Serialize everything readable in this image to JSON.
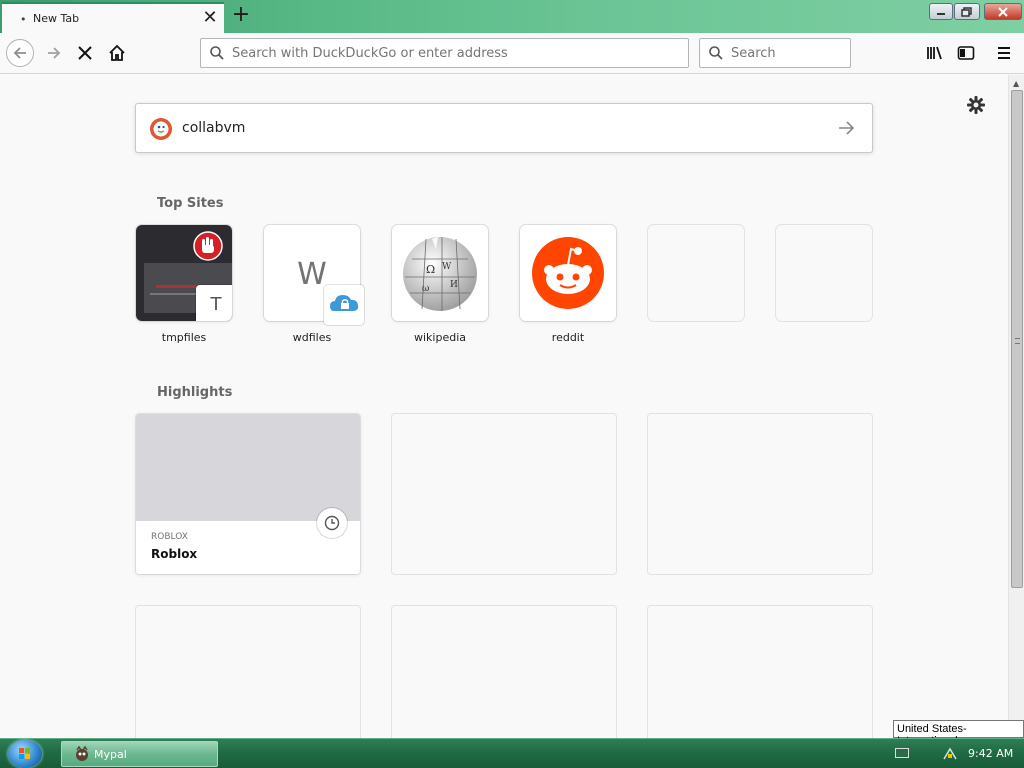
{
  "window": {
    "tab_title": "New Tab",
    "tab_dot": "•",
    "tab_close": "✕",
    "new_tab": "+"
  },
  "toolbar": {
    "url_placeholder": "Search with DuckDuckGo or enter address",
    "search_placeholder": "Search"
  },
  "newtab": {
    "search_value": "collabvm",
    "top_sites_title": "Top Sites",
    "top_sites": [
      {
        "label": "tmpfiles",
        "badge_letter": "T"
      },
      {
        "label": "wdfiles",
        "tile_letter": "W"
      },
      {
        "label": "wikipedia"
      },
      {
        "label": "reddit"
      }
    ],
    "highlights_title": "Highlights",
    "highlights": [
      {
        "source": "ROBLOX",
        "title": "Roblox"
      }
    ]
  },
  "taskbar": {
    "app_label": "Mypal",
    "clock": "9:42 AM",
    "language_tooltip": "United States-International"
  },
  "colors": {
    "titlebar": "#57b885",
    "taskbar": "#1f6a43",
    "reddit": "#ff4500",
    "duckduckgo": "#de5833"
  }
}
